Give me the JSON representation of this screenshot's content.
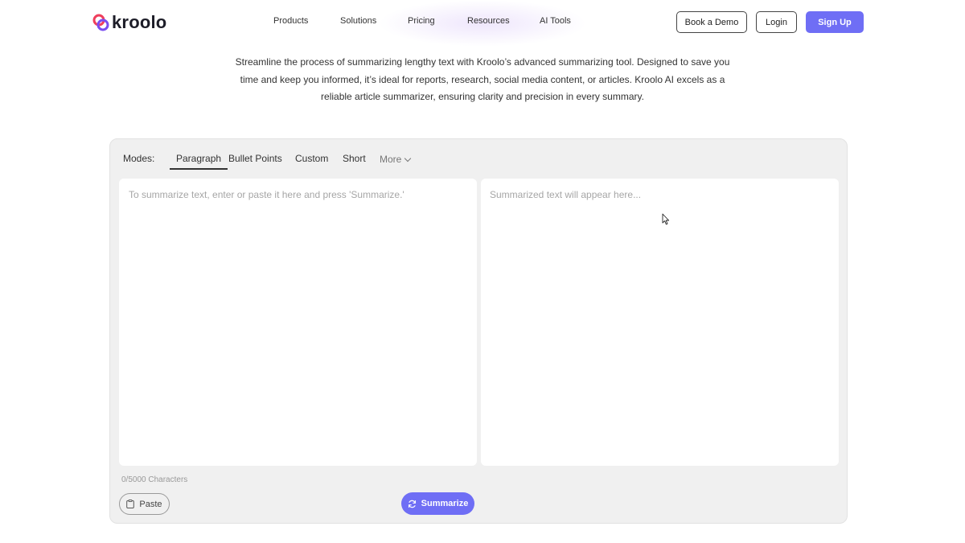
{
  "brand": {
    "name": "kroolo",
    "colors": {
      "accent": "#6f6ef5",
      "logo_red": "#ef3e5c",
      "logo_purple": "#7a4df0"
    }
  },
  "nav": {
    "items": [
      "Products",
      "Solutions",
      "Pricing",
      "Resources",
      "AI Tools"
    ]
  },
  "header_buttons": {
    "demo": "Book a Demo",
    "login": "Login",
    "signup": "Sign Up"
  },
  "intro": {
    "line1": "Streamline the process of summarizing lengthy text with Kroolo’s advanced summarizing tool. Designed to save you",
    "line2": "time and keep you informed, it’s ideal for reports, research, social media content, or articles. Kroolo AI excels as a",
    "line3": "reliable article summarizer, ensuring clarity and precision in every summary."
  },
  "tool": {
    "modes_label": "Modes:",
    "modes": [
      {
        "label": "Paragraph",
        "active": true
      },
      {
        "label": "Bullet Points",
        "active": false
      },
      {
        "label": "Custom",
        "active": false
      },
      {
        "label": "Short",
        "active": false
      }
    ],
    "more_label": "More",
    "input": {
      "value": "",
      "placeholder": "To summarize text, enter or paste it here and press 'Summarize.'"
    },
    "output_placeholder": "Summarized text will appear here...",
    "char_count": "0/5000 Characters",
    "paste_label": "Paste",
    "summarize_label": "Summarize"
  },
  "icons": {
    "logo": "kroolo-logo-icon",
    "paste": "clipboard-icon",
    "summarize": "refresh-icon",
    "more": "chevron-down-icon",
    "cursor": "mouse-pointer-icon"
  }
}
